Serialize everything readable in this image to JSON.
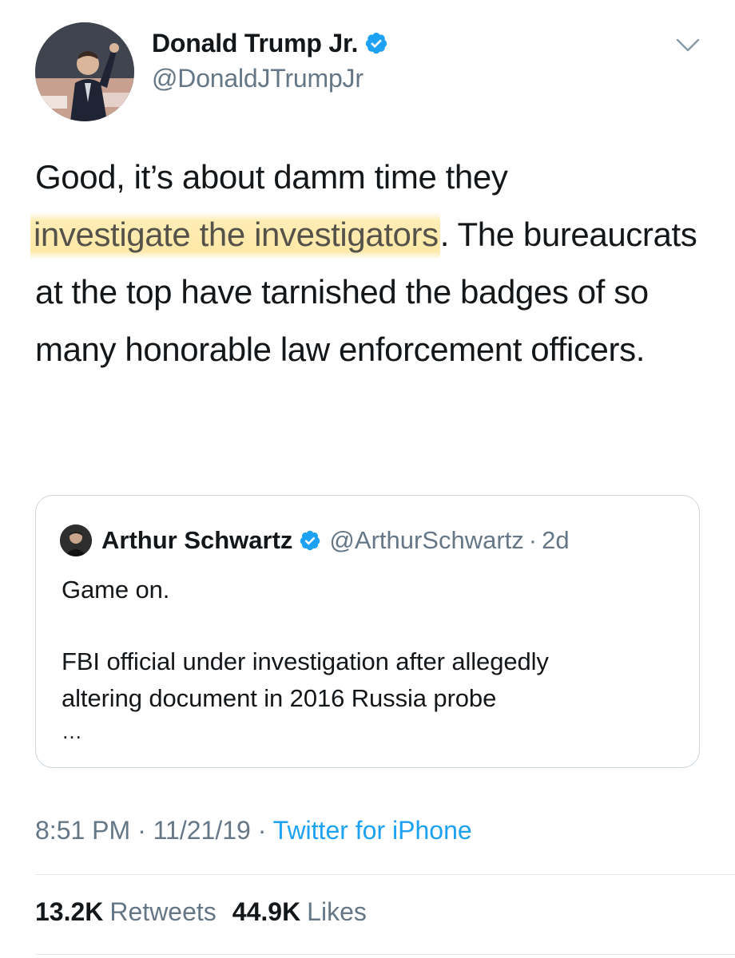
{
  "author": {
    "display_name": "Donald Trump Jr.",
    "handle": "@DonaldJTrumpJr",
    "verified": true,
    "avatar_icon": "profile-photo"
  },
  "tweet": {
    "text_before": "Good, it’s about damm time they ",
    "highlighted": "investigate the investigators",
    "text_after": ". The bureaucrats at the top have tarnished the badges of so many honorable law enforcement officers.",
    "highlight_color": "#ffdf7a"
  },
  "quote": {
    "display_name": "Arthur Schwartz",
    "handle": "@ArthurSchwartz",
    "separator": "·",
    "time": "2d",
    "line1": "Game on.",
    "line2": "FBI official under investigation after allegedly",
    "line3": "altering document in 2016 Russia probe",
    "line4": "…"
  },
  "meta": {
    "time": "8:51 PM",
    "separator": " · ",
    "date": "11/21/19",
    "source": "Twitter for iPhone"
  },
  "stats": {
    "retweets_count": "13.2K",
    "retweets_label": "Retweets",
    "likes_count": "44.9K",
    "likes_label": "Likes"
  },
  "colors": {
    "verified_blue": "#1da1f2",
    "link_blue": "#1da1f2",
    "muted_gray": "#657786"
  }
}
